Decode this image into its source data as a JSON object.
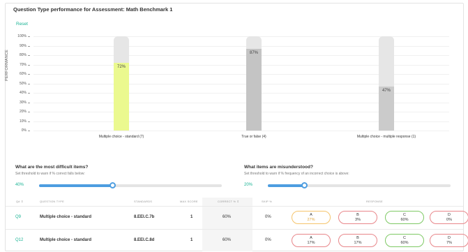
{
  "title": "Question Type performance for Assessment: Math Benchmark 1",
  "reset_label": "Reset",
  "chart_data": {
    "type": "bar",
    "ylabel": "PERFORMANCE",
    "yticks": [
      "100%",
      "90%",
      "80%",
      "70%",
      "60%",
      "50%",
      "40%",
      "30%",
      "20%",
      "10%",
      "0%"
    ],
    "ylim": [
      0,
      100
    ],
    "categories": [
      "Multiple choice - standard (7)",
      "True or false (4)",
      "Multiple choice - multiple response (1)"
    ],
    "values": [
      72,
      87,
      47
    ],
    "labels": [
      "72%",
      "87%",
      "47%"
    ],
    "colors": [
      "#ebf98f",
      "#c4c4c4",
      "#cbcbcb"
    ]
  },
  "difficult": {
    "heading": "What are the most difficult items?",
    "sub": "Set threshold to warn if % correct falls below:",
    "value_label": "40%",
    "value": 0.4
  },
  "misunderstood": {
    "heading": "What items are misunderstood?",
    "sub": "Set threshold to warn if % frequency of an incorrect choice is above:",
    "value_label": "20%",
    "value": 0.2
  },
  "table": {
    "headers": {
      "q": "Q# ⇕",
      "type": "QUESTION TYPE",
      "standards": "STANDARDS",
      "max": "MAX SCORE",
      "correct": "CORRECT % ⇕",
      "skip": "SKIP %",
      "response": "RESPONSE"
    },
    "rows": [
      {
        "q": "Q9",
        "type": "Multiple choice - standard",
        "standards": "8.EEI.C.7b",
        "max": "1",
        "correct": "60%",
        "skip": "0%",
        "responses": [
          {
            "letter": "A",
            "pct": "27%",
            "status": "warn"
          },
          {
            "letter": "B",
            "pct": "3%",
            "status": "wrong"
          },
          {
            "letter": "C",
            "pct": "60%",
            "status": "correct"
          },
          {
            "letter": "D",
            "pct": "0%",
            "status": "wrong"
          }
        ]
      },
      {
        "q": "Q12",
        "type": "Multiple choice - standard",
        "standards": "8.EEI.C.8d",
        "max": "1",
        "correct": "60%",
        "skip": "0%",
        "responses": [
          {
            "letter": "A",
            "pct": "17%",
            "status": "wrong"
          },
          {
            "letter": "B",
            "pct": "17%",
            "status": "wrong"
          },
          {
            "letter": "C",
            "pct": "60%",
            "status": "correct"
          },
          {
            "letter": "D",
            "pct": "7%",
            "status": "wrong"
          }
        ]
      }
    ]
  },
  "colors": {
    "accent": "#1ab394",
    "slider": "#4d9de0",
    "warn": "#f5c46b",
    "wrong": "#e8868a",
    "correct": "#7ec964",
    "warn_text": "#e0a43a"
  }
}
